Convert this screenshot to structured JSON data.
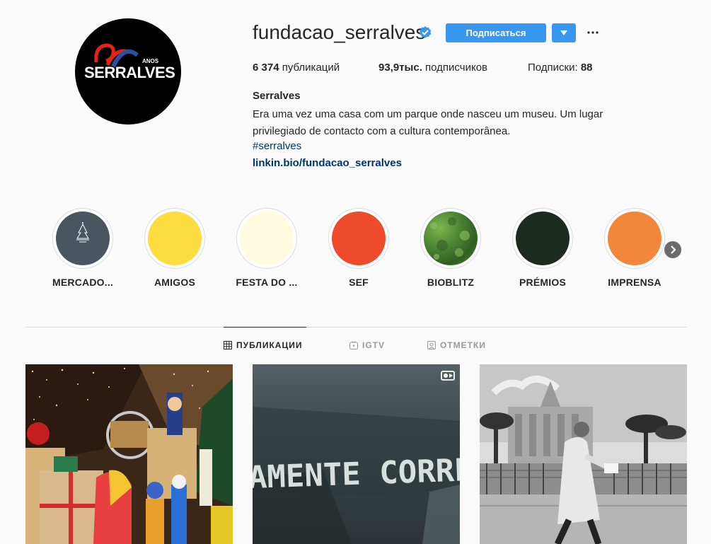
{
  "profile": {
    "username": "fundacao_serralves",
    "follow_label": "Подписаться",
    "logo_text": "SERRALVES",
    "logo_sub": "ANOS",
    "logo_number": "30"
  },
  "stats": {
    "posts_count": "6 374",
    "posts_label": "публикаций",
    "followers_count": "93,9тыс.",
    "followers_label": "подписчиков",
    "following_label": "Подписки:",
    "following_count": "88"
  },
  "bio": {
    "name": "Serralves",
    "text": "Era uma vez uma casa com um parque onde nasceu um museu. Um lugar privilegiado de contacto com a cultura contemporânea.",
    "hashtag": "#serralves",
    "link": "linkin.bio/fundacao_serralves"
  },
  "highlights": [
    {
      "label": "MERCADO...",
      "color": "#4a5560"
    },
    {
      "label": "AMIGOS",
      "color": "#fddc3f"
    },
    {
      "label": "FESTA DO ...",
      "color": "#fffbe0"
    },
    {
      "label": "SEF",
      "color": "#ef4a2b"
    },
    {
      "label": "BIOBLITZ",
      "color": "#4f8a35"
    },
    {
      "label": "PRÉMIOS",
      "color": "#1c2a20"
    },
    {
      "label": "IMPRENSA",
      "color": "#f0873a"
    }
  ],
  "tabs": [
    {
      "label": "ПУБЛИКАЦИИ",
      "icon": "grid-icon",
      "active": true
    },
    {
      "label": "IGTV",
      "icon": "igtv-icon",
      "active": false
    },
    {
      "label": "ОТМЕТКИ",
      "icon": "tagged-icon",
      "active": false
    }
  ],
  "posts": [
    {
      "icon": "photo"
    },
    {
      "caption_text": "AMENTE CORRECT",
      "icon": "video-icon"
    },
    {
      "icon": "photo"
    }
  ],
  "colors": {
    "accent": "#3897f0",
    "link": "#003569",
    "text": "#262626",
    "border": "#dbdbdb"
  }
}
